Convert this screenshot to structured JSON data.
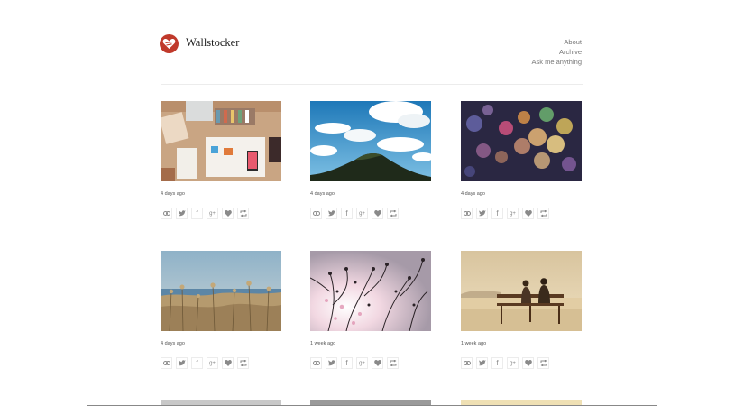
{
  "site": {
    "title": "Wallstocker"
  },
  "nav": [
    {
      "label": "About"
    },
    {
      "label": "Archive"
    },
    {
      "label": "Ask me anything"
    }
  ],
  "posts": [
    {
      "time": "4 days ago",
      "image": "desk-flatlay"
    },
    {
      "time": "4 days ago",
      "image": "sky-clouds-hill"
    },
    {
      "time": "4 days ago",
      "image": "bokeh-lights"
    },
    {
      "time": "4 days ago",
      "image": "dry-grass-sea"
    },
    {
      "time": "1 week ago",
      "image": "blossom-branches"
    },
    {
      "time": "1 week ago",
      "image": "couple-bench"
    }
  ],
  "share_icons": [
    "link-icon",
    "twitter-icon",
    "facebook-icon",
    "google-plus-icon",
    "like-heart-icon",
    "reblog-icon"
  ],
  "share_glyphs": {
    "facebook": "f",
    "google_plus": "g+"
  },
  "colors": {
    "logo": "#c0392b",
    "icon": "#8a8a8a",
    "border": "#ececec"
  }
}
